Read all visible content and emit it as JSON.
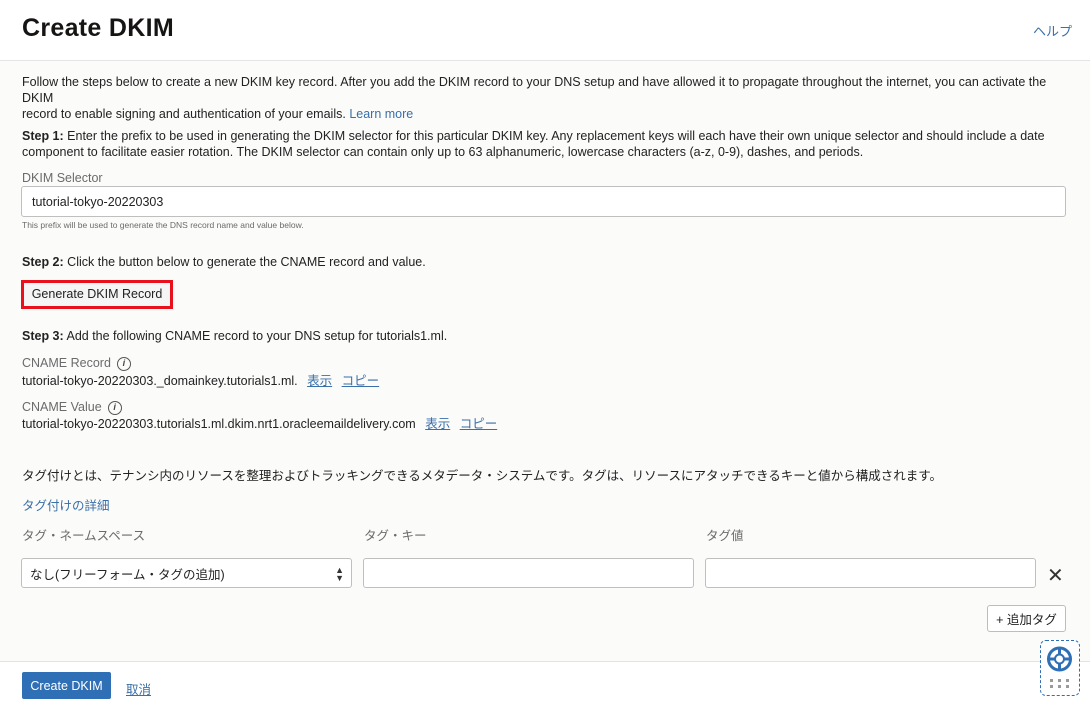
{
  "header": {
    "title": "Create DKIM",
    "help_label": "ヘルプ"
  },
  "intro": {
    "line1": "Follow the steps below to create a new DKIM key record. After you add the DKIM record to your DNS setup and have allowed it to propagate throughout the internet, you can activate the DKIM",
    "line2": "record to enable signing and authentication of your emails.",
    "learn_more": "Learn more"
  },
  "step1": {
    "label": "Step 1:",
    "text_line1": "Enter the prefix to be used in generating the DKIM selector for this particular DKIM key. Any replacement keys will each have their own unique selector and should include a date",
    "text_line2": "component to facilitate easier rotation. The DKIM selector can contain only up to 63 alphanumeric, lowercase characters (a-z, 0-9), dashes, and periods.",
    "field_label": "DKIM Selector",
    "field_value": "tutorial-tokyo-20220303",
    "hint": "This prefix will be used to generate the DNS record name and value below."
  },
  "step2": {
    "label": "Step 2:",
    "text": "Click the button below to generate the CNAME record and value.",
    "button_label": "Generate DKIM Record"
  },
  "step3": {
    "label": "Step 3:",
    "text": "Add the following CNAME record to your DNS setup for tutorials1.ml.",
    "record_label": "CNAME Record",
    "record_value": "tutorial-tokyo-20220303._domainkey.tutorials1.ml.",
    "value_label": "CNAME Value",
    "value_value": "tutorial-tokyo-20220303.tutorials1.ml.dkim.nrt1.oracleemaildelivery.com",
    "show_label": "表示",
    "copy_label": "コピー"
  },
  "tagging": {
    "description": "タグ付けとは、テナンシ内のリソースを整理およびトラッキングできるメタデータ・システムです。タグは、リソースにアタッチできるキーと値から構成されます。",
    "details_link": "タグ付けの詳細",
    "namespace_label": "タグ・ネームスペース",
    "key_label": "タグ・キー",
    "value_label": "タグ値",
    "namespace_selected": "なし(フリーフォーム・タグの追加)",
    "key_value": "",
    "value_value": "",
    "remove_icon": "close-icon",
    "add_tag_label": "+ 追加タグ"
  },
  "footer": {
    "create_label": "Create DKIM",
    "cancel_label": "取消"
  },
  "colors": {
    "accent": "#2f6fb5",
    "highlight": "#e8101a",
    "link": "#3a6fa8"
  }
}
